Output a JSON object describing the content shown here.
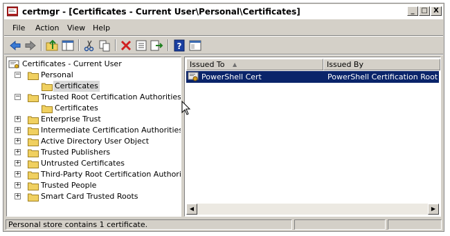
{
  "window": {
    "title": "certmgr - [Certificates - Current User\\Personal\\Certificates]",
    "controls": {
      "minimize": "_",
      "maximize": "□",
      "close": "X"
    }
  },
  "menu": [
    "File",
    "Action",
    "View",
    "Help"
  ],
  "toolbar": {
    "icons": [
      "back-icon",
      "forward-icon",
      "up-folder-icon",
      "show-hide-tree-icon",
      "cut-icon",
      "copy-icon",
      "delete-icon",
      "properties-icon",
      "export-icon",
      "help-icon",
      "console-tree-icon"
    ]
  },
  "tree": {
    "root": "Certificates - Current User",
    "items": [
      {
        "label": "Personal",
        "expander": "−"
      },
      {
        "label": "Certificates",
        "selected": true
      },
      {
        "label": "Trusted Root Certification Authorities",
        "expander": "−"
      },
      {
        "label": "Certificates"
      },
      {
        "label": "Enterprise Trust",
        "expander": "+"
      },
      {
        "label": "Intermediate Certification Authorities",
        "expander": "+"
      },
      {
        "label": "Active Directory User Object",
        "expander": "+"
      },
      {
        "label": "Trusted Publishers",
        "expander": "+"
      },
      {
        "label": "Untrusted Certificates",
        "expander": "+"
      },
      {
        "label": "Third-Party Root Certification Authorities",
        "expander": "+"
      },
      {
        "label": "Trusted People",
        "expander": "+"
      },
      {
        "label": "Smart Card Trusted Roots",
        "expander": "+"
      }
    ]
  },
  "list": {
    "columns": [
      "Issued To",
      "Issued By"
    ],
    "rows": [
      {
        "issued_to": "PowerShell Cert",
        "issued_by": "PowerShell Certification Root",
        "selected": true
      }
    ]
  },
  "status": {
    "text": "Personal store contains 1 certificate."
  },
  "colors": {
    "selection": "#0a246a",
    "folder": "#f0d060",
    "window_bg": "#d4d0c8"
  }
}
